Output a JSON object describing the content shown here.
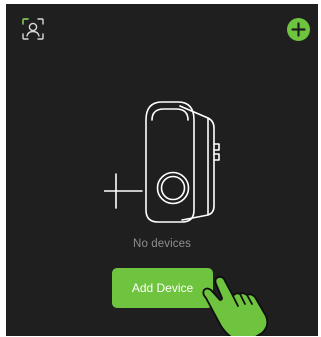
{
  "header": {
    "scan_icon": "scan-face-icon",
    "add_icon": "plus-circle-icon"
  },
  "empty_state": {
    "illustration": "wallbox-charger-illustration",
    "plus_glyph": "+",
    "message": "No devices",
    "button_label": "Add Device",
    "pointer_icon": "pointing-hand-icon"
  },
  "colors": {
    "background": "#1f1f1f",
    "accent": "#6ec33f",
    "illustration_stroke": "#ffffff",
    "muted_text": "#8e8e8e"
  }
}
